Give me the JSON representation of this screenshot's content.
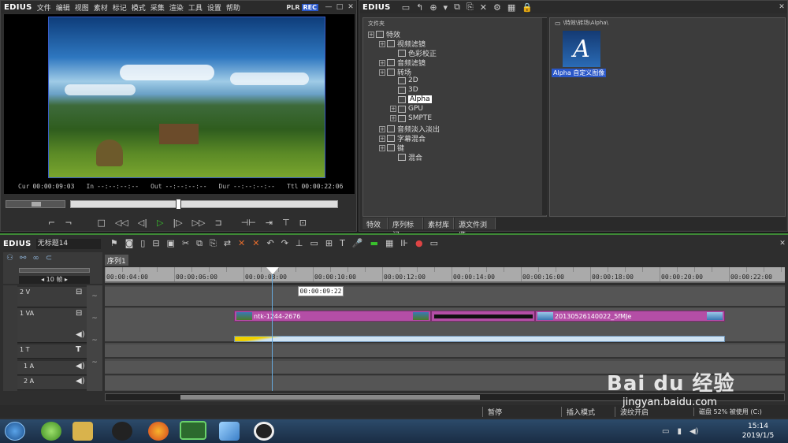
{
  "player": {
    "logo": "EDIUS",
    "menu": [
      "文件",
      "编辑",
      "视图",
      "素材",
      "标记",
      "模式",
      "采集",
      "渲染",
      "工具",
      "设置",
      "帮助"
    ],
    "plr": "PLR",
    "rec": "REC",
    "cur_label": "Cur",
    "cur_value": "00:00:09:03",
    "in_label": "In",
    "in_value": "--:--:--:--",
    "out_label": "Out",
    "out_value": "--:--:--:--",
    "dur_label": "Dur",
    "dur_value": "--:--:--:--",
    "ttl_label": "Ttl",
    "ttl_value": "00:00:22:06"
  },
  "bin": {
    "logo": "EDIUS",
    "folder_label": "文件夹",
    "path": "\\特效\\转场\\Alpha\\",
    "tree": [
      {
        "label": "特效",
        "level": 0
      },
      {
        "label": "视频滤镜",
        "level": 1
      },
      {
        "label": "色彩校正",
        "level": 2
      },
      {
        "label": "音频滤镜",
        "level": 1
      },
      {
        "label": "转场",
        "level": 1
      },
      {
        "label": "2D",
        "level": 2
      },
      {
        "label": "3D",
        "level": 2
      },
      {
        "label": "Alpha",
        "level": 2
      },
      {
        "label": "GPU",
        "level": 2
      },
      {
        "label": "SMPTE",
        "level": 2
      },
      {
        "label": "音频淡入淡出",
        "level": 1
      },
      {
        "label": "字幕混合",
        "level": 1
      },
      {
        "label": "键",
        "level": 1
      },
      {
        "label": "混合",
        "level": 2
      }
    ],
    "effect_thumb_letter": "A",
    "effect_name": "Alpha 自定义图像",
    "tabs": [
      "特效",
      "序列标记",
      "素材库",
      "源文件浏览"
    ]
  },
  "timeline": {
    "logo": "EDIUS",
    "project_name": "无标题14",
    "sequence_tab": "序列1",
    "zoom_label": "10 帧",
    "ruler": [
      "00:00:04:00",
      "00:00:06:00",
      "00:00:08:00",
      "00:00:10:00",
      "00:00:12:00",
      "00:00:14:00",
      "00:00:16:00",
      "00:00:18:00",
      "00:00:20:00",
      "00:00:22:00"
    ],
    "tooltip": "00:00:09:22",
    "tracks": [
      {
        "name": "2 V"
      },
      {
        "name": "1 VA"
      },
      {
        "name": "1 T"
      },
      {
        "name": "1 A"
      },
      {
        "name": "2 A"
      }
    ],
    "clip1_name": "ntk-1244-2676",
    "clip2_name": "20130526140022_5fMJe",
    "status_pause": "暂停",
    "status_insert": "插入模式",
    "status_wave": "波纹开启",
    "status_disk": "磁盘 52% 被使用 (C:)"
  },
  "taskbar": {
    "time": "15:14",
    "date": "2019/1/5"
  },
  "watermark": {
    "brand": "Bai du 经验",
    "url": "jingyan.baidu.com"
  },
  "colors": {
    "clip_purple": "#b44ea6",
    "rec_blue": "#2a57c8",
    "accent_green": "#39c02c"
  }
}
